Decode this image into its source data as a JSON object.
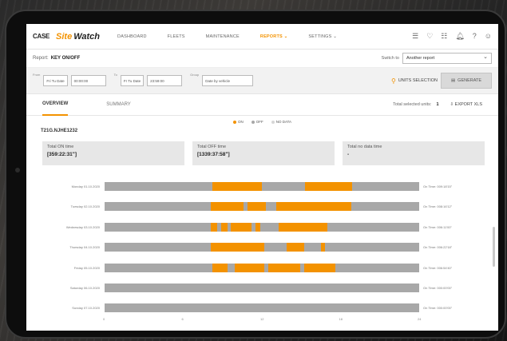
{
  "brand": {
    "case": "CASE",
    "site": "Site",
    "watch": "Watch"
  },
  "nav": [
    {
      "label": "DASHBOARD",
      "active": false
    },
    {
      "label": "FLEETS",
      "active": false
    },
    {
      "label": "MAINTENANCE",
      "active": false
    },
    {
      "label": "REPORTS ⌄",
      "active": true
    },
    {
      "label": "SETTINGS ⌄",
      "active": false
    }
  ],
  "top_icons": [
    "list-icon",
    "heart-icon",
    "document-icon",
    "bell-icon",
    "help-icon",
    "user-icon"
  ],
  "report": {
    "label": "Report:",
    "value": "KEY ON/OFF",
    "goto_label": "Switch to",
    "goto_value": "Another report"
  },
  "filters": {
    "from_label": "From",
    "from_date": "Fri Tu Date",
    "from_time": "00:00:00",
    "to_label": "To",
    "to_date": "Fr Tu Date",
    "to_time": "23:59:00",
    "group_label": "Group",
    "group_value": "Date by vehicle",
    "units_label": "UNITS SELECTION",
    "generate_label": "GENERATE"
  },
  "tabs": [
    {
      "label": "OVERVIEW",
      "active": true
    },
    {
      "label": "SUMMARY",
      "active": false
    }
  ],
  "total_selected": {
    "label": "Total selected units:",
    "value": "1"
  },
  "export_label": "EXPORT XLS",
  "legend": [
    {
      "label": "ON",
      "color": "#f39200"
    },
    {
      "label": "OFF",
      "color": "#a8a8a8"
    },
    {
      "label": "NO DATA",
      "color": "#d6d6d6"
    }
  ],
  "vehicle": "T21G.NJHE1232",
  "totals": [
    {
      "title": "Total ON time",
      "value": "[359:22:31\"]"
    },
    {
      "title": "Total OFF time",
      "value": "[1339:37:58\"]"
    },
    {
      "title": "Total no data time",
      "value": "-"
    }
  ],
  "chart_data": {
    "type": "bar",
    "xlim": [
      0,
      24
    ],
    "xticks": [
      "0",
      "6",
      "12",
      "18",
      "24"
    ],
    "rows": [
      {
        "label": "Monday 01.10.2020",
        "on_time": "On Time: 009:18'15\"",
        "segments": [
          [
            8.2,
            12
          ],
          [
            15.3,
            18.9
          ]
        ]
      },
      {
        "label": "Tuesday 02.10.2020",
        "on_time": "On Time: 008:16'12\"",
        "segments": [
          [
            8.1,
            10.6
          ],
          [
            10.9,
            12.3
          ],
          [
            13.1,
            18.8
          ]
        ]
      },
      {
        "label": "Wednesday 03.10.2020",
        "on_time": "On Time: 006:11'00\"",
        "segments": [
          [
            8.1,
            8.6
          ],
          [
            8.9,
            9.4
          ],
          [
            9.6,
            11.2
          ],
          [
            11.5,
            11.9
          ],
          [
            13.3,
            17
          ]
        ]
      },
      {
        "label": "Thursday 04.10.2020",
        "on_time": "On Time: 006:22'18\"",
        "segments": [
          [
            8.1,
            12.2
          ],
          [
            13.9,
            15.2
          ],
          [
            16.5,
            16.8
          ]
        ]
      },
      {
        "label": "Friday 05.10.2020",
        "on_time": "On Time: 006:54'40\"",
        "segments": [
          [
            8.2,
            9.4
          ],
          [
            9.9,
            12.2
          ],
          [
            12.5,
            14.9
          ],
          [
            15.2,
            17.6
          ]
        ]
      },
      {
        "label": "Saturday 06.10.2020",
        "on_time": "On Time: 000:00'00\"",
        "segments": []
      },
      {
        "label": "Sunday 07.10.2020",
        "on_time": "On Time: 000:00'00\"",
        "segments": []
      }
    ]
  }
}
